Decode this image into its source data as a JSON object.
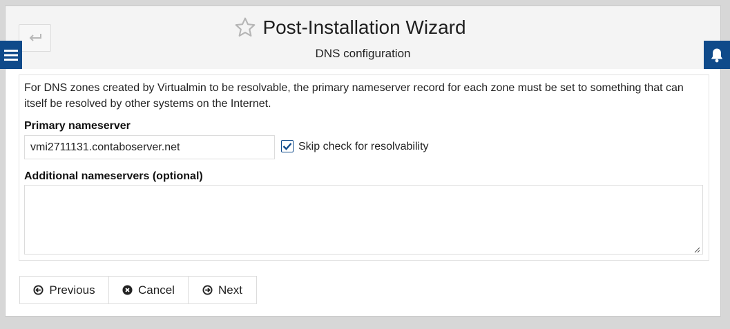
{
  "header": {
    "title": "Post-Installation Wizard",
    "subtitle": "DNS configuration"
  },
  "icons": {
    "back": "return-arrow-icon",
    "favorite": "star-icon",
    "menu": "hamburger-menu-icon",
    "notifications": "bell-icon",
    "previous": "arrow-circle-left-icon",
    "cancel": "times-circle-icon",
    "next": "arrow-circle-right-icon"
  },
  "colors": {
    "accent": "#0f4a8a",
    "header_bg": "#f4f4f4",
    "page_bg": "#d7d7d7"
  },
  "form": {
    "description": "For DNS zones created by Virtualmin to be resolvable, the primary nameserver record for each zone must be set to something that can itself be resolved by other systems on the Internet.",
    "primary_label": "Primary nameserver",
    "primary_value": "vmi2711131.contaboserver.net",
    "skip_check_label": "Skip check for resolvability",
    "skip_check_checked": true,
    "additional_label": "Additional nameservers (optional)",
    "additional_value": ""
  },
  "buttons": {
    "previous": "Previous",
    "cancel": "Cancel",
    "next": "Next"
  }
}
